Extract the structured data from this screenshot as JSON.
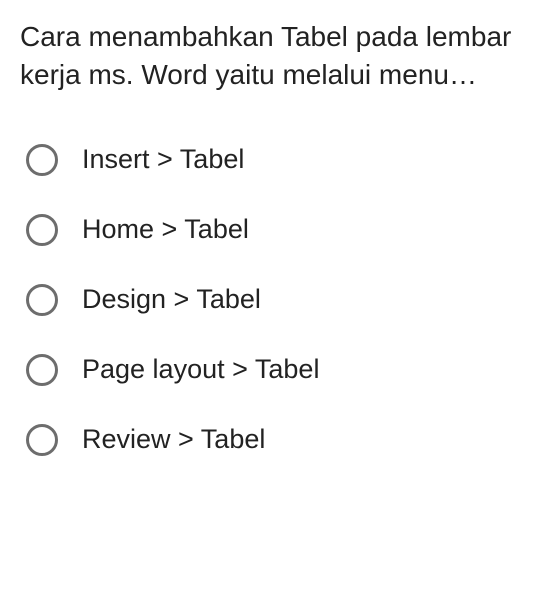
{
  "question": {
    "text": "Cara menambahkan Tabel pada lembar kerja ms. Word yaitu melalui menu…"
  },
  "options": [
    {
      "label": "Insert > Tabel"
    },
    {
      "label": "Home > Tabel"
    },
    {
      "label": "Design > Tabel"
    },
    {
      "label": "Page layout > Tabel"
    },
    {
      "label": "Review > Tabel"
    }
  ]
}
